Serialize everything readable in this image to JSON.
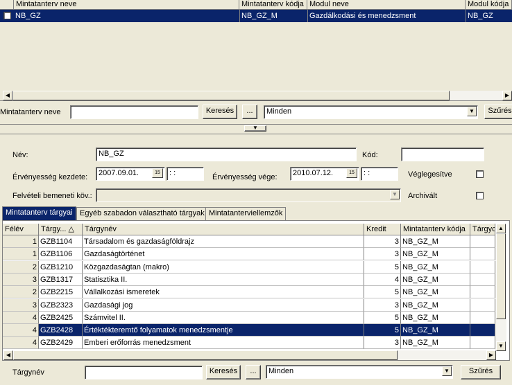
{
  "top_grid": {
    "columns": [
      "Mintatanterv neve",
      "Mintatanterv kódja",
      "Modul neve",
      "Modul kódja"
    ],
    "rows": [
      {
        "name": "NB_GZ",
        "code": "NB_GZ_M",
        "module": "Gazdálkodási és menedzsment",
        "module_code": "NB_GZ"
      }
    ]
  },
  "search_bar": {
    "label": "Mintatanterv neve",
    "input_value": "",
    "search_button": "Keresés",
    "dots_button": "...",
    "filter_value": "Minden",
    "filter_button": "Szűrés"
  },
  "form": {
    "name_label": "Név:",
    "name_value": "NB_GZ",
    "code_label": "Kód:",
    "code_value": "",
    "valid_from_label": "Érvényesség kezdete:",
    "valid_from_value": "2007.09.01.",
    "valid_from_time": " :  :",
    "valid_to_label": "Érvényesség vége:",
    "valid_to_value": "2010.07.12.",
    "valid_to_time": " :  :",
    "calendar_icon_text": "15",
    "finalized_label": "Véglegesítve",
    "finalized_checked": false,
    "entry_label": "Felvételi bemeneti köv.:",
    "entry_value": "",
    "archived_label": "Archivált",
    "archived_checked": false
  },
  "tabs": [
    {
      "label": "Mintatanterv tárgyai",
      "active": true
    },
    {
      "label": "Egyéb szabadon választható tárgyak",
      "active": false
    },
    {
      "label": "Mintatanterviellemzők",
      "active": false
    }
  ],
  "subject_grid": {
    "columns": [
      "Félév",
      "Tárgy... △",
      "Tárgynév",
      "Kredit",
      "Mintatanterv kódja",
      "Tárgyc"
    ],
    "rows": [
      {
        "semester": "1",
        "code": "GZB1104",
        "name": "Társadalom és gazdaságföldrajz",
        "credit": "3",
        "plan_code": "NB_GZ_M",
        "selected": false
      },
      {
        "semester": "1",
        "code": "GZB1106",
        "name": "Gazdaságtörténet",
        "credit": "3",
        "plan_code": "NB_GZ_M",
        "selected": false
      },
      {
        "semester": "2",
        "code": "GZB1210",
        "name": "Közgazdaságtan (makro)",
        "credit": "5",
        "plan_code": "NB_GZ_M",
        "selected": false
      },
      {
        "semester": "3",
        "code": "GZB1317",
        "name": "Statisztika II.",
        "credit": "4",
        "plan_code": "NB_GZ_M",
        "selected": false
      },
      {
        "semester": "2",
        "code": "GZB2215",
        "name": "Vállalkozási ismeretek",
        "credit": "5",
        "plan_code": "NB_GZ_M",
        "selected": false
      },
      {
        "semester": "3",
        "code": "GZB2323",
        "name": "Gazdasági jog",
        "credit": "3",
        "plan_code": "NB_GZ_M",
        "selected": false
      },
      {
        "semester": "4",
        "code": "GZB2425",
        "name": "Számvitel II.",
        "credit": "5",
        "plan_code": "NB_GZ_M",
        "selected": false
      },
      {
        "semester": "4",
        "code": "GZB2428",
        "name": "Értéktékteremtő folyamatok menedzsmentje",
        "credit": "5",
        "plan_code": "NB_GZ_M",
        "selected": true
      },
      {
        "semester": "4",
        "code": "GZB2429",
        "name": "Emberi erőforrás menedzsment",
        "credit": "3",
        "plan_code": "NB_GZ_M",
        "selected": false
      }
    ]
  },
  "bottom_bar": {
    "label": "Tárgynév",
    "input_value": "",
    "search_button": "Keresés",
    "dots_button": "...",
    "filter_value": "Minden",
    "filter_button": "Szűrés"
  },
  "colors": {
    "selection": "#0a246a",
    "window_bg": "#ece9d8"
  }
}
